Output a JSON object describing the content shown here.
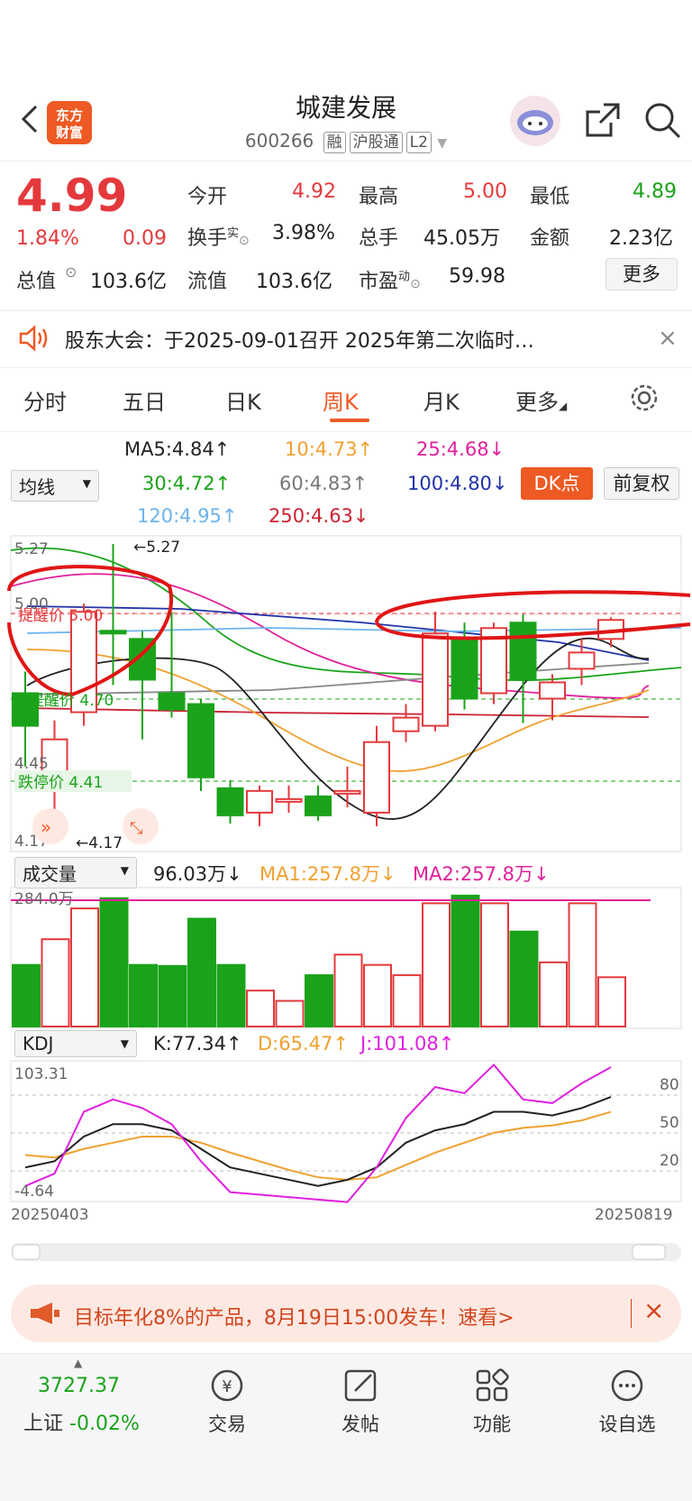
{
  "header": {
    "title": "城建发展",
    "code": "600266",
    "tags": [
      "融",
      "沪股通",
      "L2"
    ],
    "logo_text": "东方财富"
  },
  "quote": {
    "price": "4.99",
    "change_pct": "1.84%",
    "change": "0.09",
    "open_label": "今开",
    "open": "4.92",
    "high_label": "最高",
    "high": "5.00",
    "low_label": "最低",
    "low": "4.89",
    "turnover_label": "换手",
    "turnover_sup": "实",
    "turnover": "3.98%",
    "volume_label": "总手",
    "volume": "45.05万",
    "amount_label": "金额",
    "amount": "2.23亿",
    "mcap_label": "总值",
    "mcap": "103.6亿",
    "float_label": "流值",
    "float": "103.6亿",
    "pe_label": "市盈",
    "pe_sup": "动",
    "pe": "59.98",
    "more": "更多"
  },
  "notice": {
    "text": "股东大会：于2025-09-01召开 2025年第二次临时…"
  },
  "tabs": [
    {
      "label": "分时"
    },
    {
      "label": "五日"
    },
    {
      "label": "日K"
    },
    {
      "label": "周K"
    },
    {
      "label": "月K"
    },
    {
      "label": "更多"
    }
  ],
  "ma": {
    "selector": "均线",
    "ma5": "MA5:4.84↑",
    "ma10": "10:4.73↑",
    "ma25": "25:4.68↓",
    "ma30": "30:4.72↑",
    "ma60": "60:4.83↑",
    "ma100": "100:4.80↓",
    "ma120": "120:4.95↑",
    "ma250": "250:4.63↓",
    "dk": "DK点",
    "fq": "前复权"
  },
  "kline": {
    "y_top": "5.27",
    "y_500": "5.00",
    "y_445": "4.45",
    "y_bottom": "4.17",
    "max_label": "←5.27",
    "min_label": "←4.17",
    "alert_label": "提醒价 5.00",
    "alert2_label": "提醒价 4.70",
    "limit_down_label": "跌停价 4.41"
  },
  "volume": {
    "selector": "成交量",
    "value": "96.03万↓",
    "ma1": "MA1:257.8万↓",
    "ma2": "MA2:257.8万↓",
    "y_top": "284.0万"
  },
  "kdj": {
    "selector": "KDJ",
    "k": "K:77.34↑",
    "d": "D:65.47↑",
    "j": "J:101.08↑",
    "y_top": "103.31",
    "y_bottom": "-4.64",
    "l80": "80",
    "l50": "50",
    "l20": "20",
    "date_start": "20250403",
    "date_end": "20250819"
  },
  "ad": {
    "text": "目标年化8%的产品，8月19日15:00发车！速看>"
  },
  "bottom_nav": {
    "index_value": "3727.37",
    "index_name": "上证",
    "index_change": "-0.02%",
    "items": [
      {
        "label": "交易"
      },
      {
        "label": "发帖"
      },
      {
        "label": "功能"
      },
      {
        "label": "设自选"
      }
    ]
  },
  "colors": {
    "up": "#e4393c",
    "down": "#1aa31a",
    "accent": "#ee5a24"
  },
  "chart_data": {
    "type": "candlestick",
    "y_range": [
      4.17,
      5.27
    ],
    "candles": [
      {
        "o": 4.72,
        "c": 4.6,
        "h": 4.8,
        "l": 4.45
      },
      {
        "o": 4.4,
        "c": 4.55,
        "h": 4.62,
        "l": 4.17
      },
      {
        "o": 4.65,
        "c": 5.02,
        "h": 5.05,
        "l": 4.6
      },
      {
        "o": 4.95,
        "c": 4.94,
        "h": 5.27,
        "l": 4.75
      },
      {
        "o": 4.92,
        "c": 4.77,
        "h": 4.95,
        "l": 4.55
      },
      {
        "o": 4.72,
        "c": 4.66,
        "h": 5.02,
        "l": 4.63
      },
      {
        "o": 4.68,
        "c": 4.41,
        "h": 4.7,
        "l": 4.36
      },
      {
        "o": 4.37,
        "c": 4.27,
        "h": 4.4,
        "l": 4.24
      },
      {
        "o": 4.28,
        "c": 4.36,
        "h": 4.38,
        "l": 4.23
      },
      {
        "o": 4.32,
        "c": 4.33,
        "h": 4.38,
        "l": 4.28
      },
      {
        "o": 4.34,
        "c": 4.27,
        "h": 4.38,
        "l": 4.25
      },
      {
        "o": 4.35,
        "c": 4.36,
        "h": 4.45,
        "l": 4.3
      },
      {
        "o": 4.28,
        "c": 4.54,
        "h": 4.6,
        "l": 4.23
      },
      {
        "o": 4.58,
        "c": 4.63,
        "h": 4.68,
        "l": 4.54
      },
      {
        "o": 4.6,
        "c": 4.94,
        "h": 5.02,
        "l": 4.58
      },
      {
        "o": 4.92,
        "c": 4.7,
        "h": 4.98,
        "l": 4.66
      },
      {
        "o": 4.72,
        "c": 4.96,
        "h": 4.98,
        "l": 4.68
      },
      {
        "o": 4.98,
        "c": 4.77,
        "h": 5.01,
        "l": 4.61
      },
      {
        "o": 4.7,
        "c": 4.76,
        "h": 4.79,
        "l": 4.62
      },
      {
        "o": 4.81,
        "c": 4.87,
        "h": 4.92,
        "l": 4.75
      },
      {
        "o": 4.92,
        "c": 4.99,
        "h": 5.0,
        "l": 4.89
      }
    ],
    "volume": [
      120,
      170,
      230,
      250,
      120,
      118,
      210,
      120,
      70,
      50,
      100,
      140,
      120,
      100,
      240,
      255,
      240,
      185,
      125,
      240,
      96
    ],
    "kdj_k": [
      20,
      25,
      45,
      55,
      55,
      50,
      35,
      20,
      15,
      10,
      5,
      10,
      20,
      40,
      50,
      55,
      65,
      65,
      62,
      68,
      77
    ],
    "kdj_d": [
      30,
      28,
      35,
      40,
      45,
      45,
      40,
      32,
      25,
      18,
      12,
      10,
      12,
      22,
      32,
      40,
      48,
      52,
      54,
      58,
      65
    ],
    "kdj_j": [
      5,
      15,
      65,
      75,
      68,
      55,
      25,
      0,
      -2,
      -4,
      -6,
      -8,
      20,
      60,
      85,
      80,
      103,
      75,
      72,
      88,
      101
    ]
  }
}
